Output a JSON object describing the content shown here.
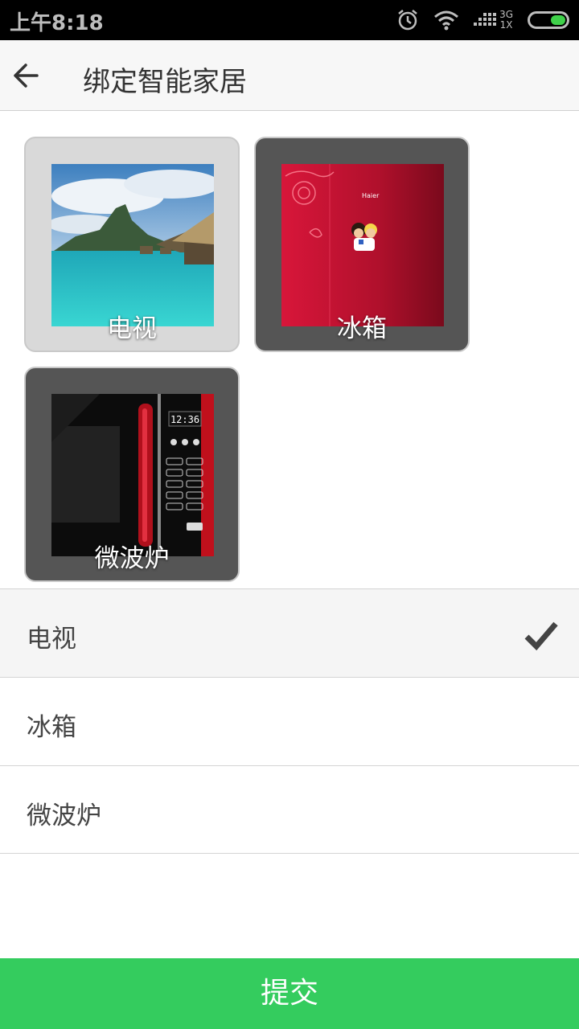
{
  "status_bar": {
    "time": "上午8:18",
    "network_top": "3G",
    "network_bottom": "1X",
    "icons": [
      "alarm-icon",
      "wifi-icon",
      "signal-icon",
      "battery-icon"
    ],
    "battery_color": "#3fd14a"
  },
  "app_bar": {
    "back_icon": "arrow-left-icon",
    "title": "绑定智能家居"
  },
  "devices": [
    {
      "label": "电视",
      "selected": true
    },
    {
      "label": "冰箱",
      "selected": false
    },
    {
      "label": "微波炉",
      "selected": false
    }
  ],
  "tile_images": {
    "tv": "tropical-lagoon-photo",
    "fridge_brand": "Haier",
    "microwave_display": "12:36"
  },
  "list": [
    {
      "label": "电视",
      "checked": true
    },
    {
      "label": "冰箱",
      "checked": false
    },
    {
      "label": "微波炉",
      "checked": false
    }
  ],
  "submit_label": "提交",
  "colors": {
    "accent": "#34cc5e",
    "selected_tile": "#d9d9d9",
    "tile": "#555555"
  }
}
